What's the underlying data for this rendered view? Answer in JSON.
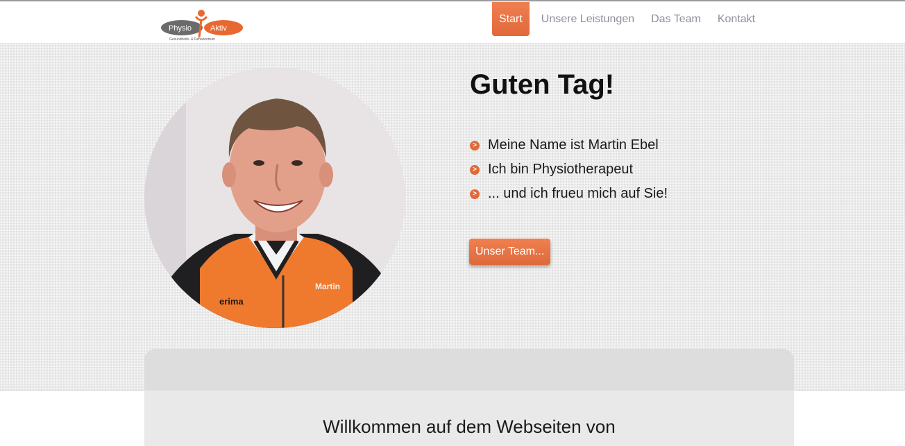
{
  "header": {
    "logo": {
      "text_left": "Physio",
      "text_right": "Aktiv",
      "tagline": "Gesundheits- & Rehazentrum"
    },
    "nav": [
      {
        "label": "Start",
        "active": true
      },
      {
        "label": "Unsere Leistungen",
        "active": false
      },
      {
        "label": "Das Team",
        "active": false
      },
      {
        "label": "Kontakt",
        "active": false
      }
    ]
  },
  "hero": {
    "title": "Guten Tag!",
    "bullets": [
      "Meine Name ist Martin Ebel",
      "Ich bin Physiotherapeut",
      "... und ich frueu mich auf Sie!"
    ],
    "bullet_glyph": ">",
    "button_label": "Unser Team...",
    "portrait": {
      "shirt_brand": "erima",
      "shirt_name": "Martin"
    }
  },
  "welcome": {
    "heading": "Willkommen auf dem Webseiten von"
  },
  "colors": {
    "accent": "#e5713f",
    "nav_text": "#8f8f9c",
    "background": "#ececec"
  }
}
